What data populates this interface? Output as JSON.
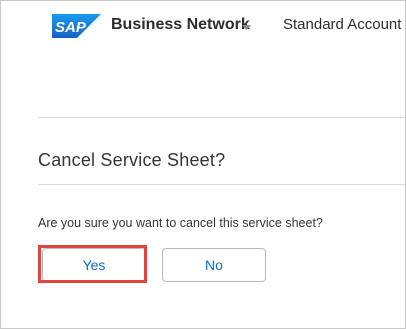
{
  "header": {
    "logo_text": "SAP",
    "brand": "Business Network",
    "brand_chevron_icon": "chevron-down-icon",
    "account_type": "Standard Account"
  },
  "dialog": {
    "title": "Cancel Service Sheet?",
    "message": "Are you sure you want to cancel this service sheet?",
    "buttons": {
      "yes_label": "Yes",
      "no_label": "No"
    }
  },
  "colors": {
    "sap_logo_blue": "#1b7ad8",
    "link_blue": "#0a6ed1",
    "highlight_red": "#e0453f"
  }
}
